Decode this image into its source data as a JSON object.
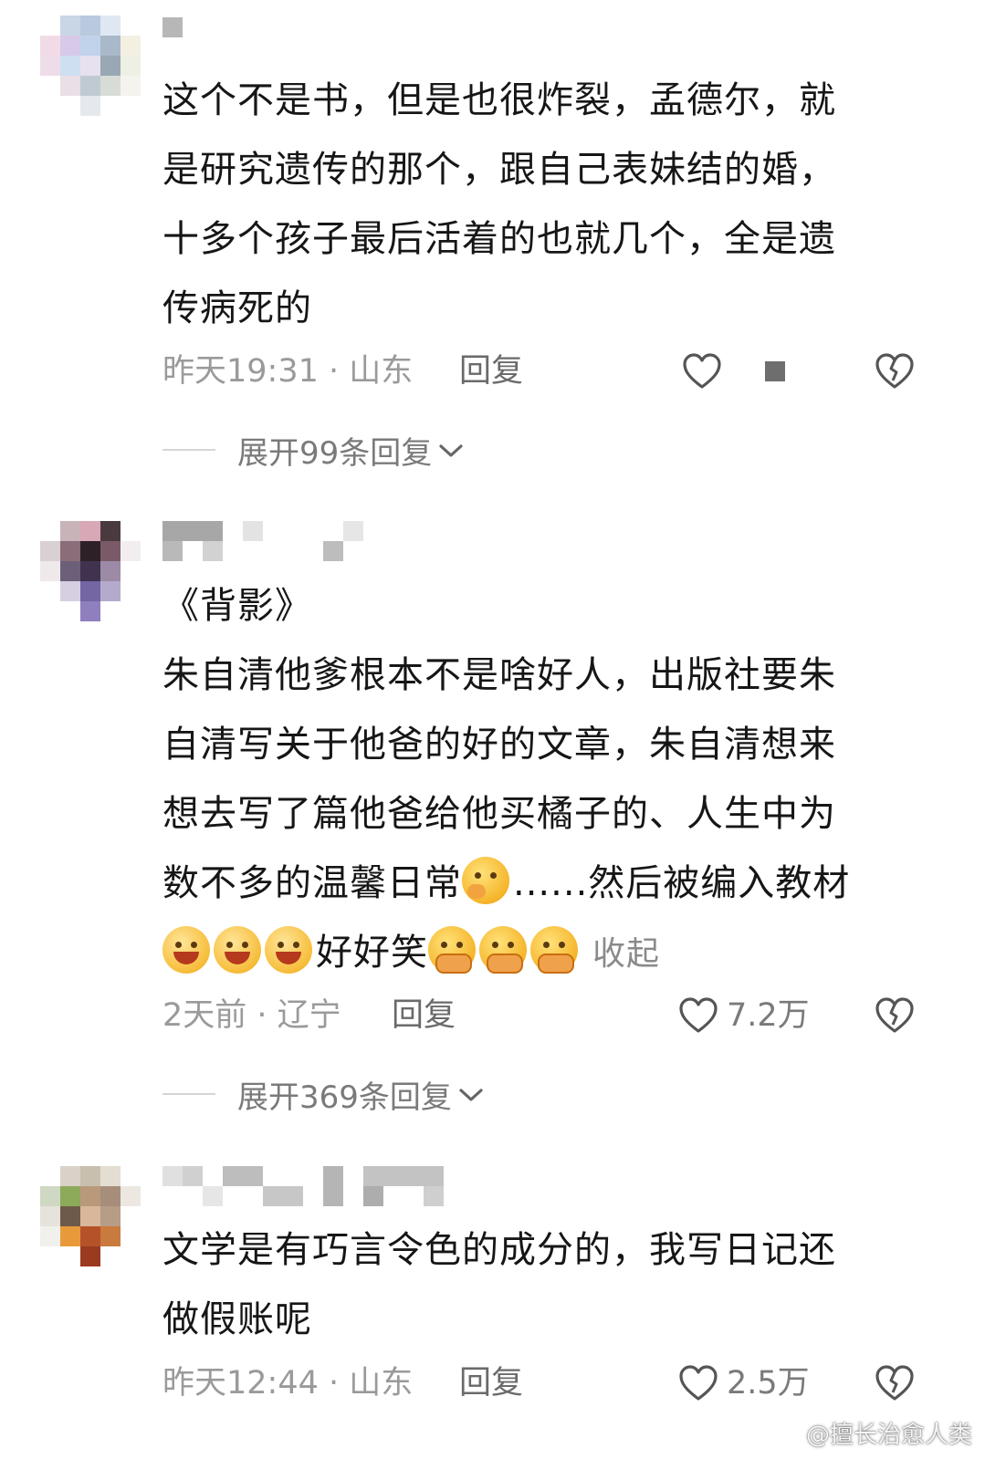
{
  "comments": [
    {
      "lines": [
        "这个不是书，但是也很炸裂，孟德尔，就",
        "是研究遗传的那个，跟自己表妹结的婚，",
        "十多个孩子最后活着的也就几个，全是遗",
        "传病死的"
      ],
      "meta": "昨天19:31 · 山东",
      "reply_label": "回复",
      "likes": "",
      "expand_label": "展开99条回复"
    },
    {
      "lines": [
        "《背影》",
        "朱自清他爹根本不是啥好人，出版社要朱",
        "自清写关于他爸的好的文章，朱自清想来",
        "想去写了篇他爸给他买橘子的、人生中为",
        "数不多的温馨日常",
        "......然后被编入教材",
        "好好笑",
        "收起"
      ],
      "meta": "2天前 · 辽宁",
      "reply_label": "回复",
      "likes": "7.2万",
      "expand_label": "展开369条回复"
    },
    {
      "lines": [
        "文学是有巧言令色的成分的，我写日记还",
        "做假账呢"
      ],
      "meta": "昨天12:44 · 山东",
      "reply_label": "回复",
      "likes": "2.5万"
    }
  ],
  "emoji": {
    "thinking": "thinking-face-icon",
    "grin": "grinning-face-icon",
    "crying": "holding-back-tears-icon"
  },
  "watermark": "@擅长治愈人类",
  "colors": {
    "text": "#161616",
    "meta": "#9a9a9a",
    "accent_muted": "#7a7a7a",
    "background": "#ffffff"
  }
}
